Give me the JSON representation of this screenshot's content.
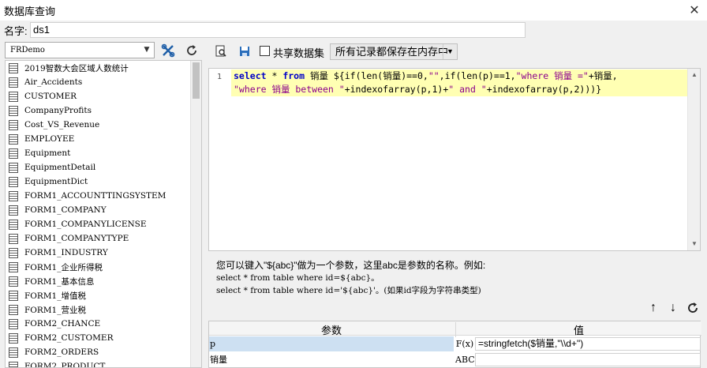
{
  "window": {
    "title": "数据库查询",
    "close_glyph": "✕"
  },
  "name_field": {
    "label": "名字:",
    "value": "ds1"
  },
  "left_panel": {
    "database_select": "FRDemo",
    "tables": [
      "2019智数大会区域人数统计",
      "Air_Accidents",
      "CUSTOMER",
      "CompanyProfits",
      "Cost_VS_Revenue",
      "EMPLOYEE",
      "Equipment",
      "EquipmentDetail",
      "EquipmentDict",
      "FORM1_ACCOUNTTINGSYSTEM",
      "FORM1_COMPANY",
      "FORM1_COMPANYLICENSE",
      "FORM1_COMPANYTYPE",
      "FORM1_INDUSTRY",
      "FORM1_企业所得税",
      "FORM1_基本信息",
      "FORM1_增值税",
      "FORM1_营业税",
      "FORM2_CHANCE",
      "FORM2_CUSTOMER",
      "FORM2_ORDERS",
      "FORM2_PRODUCT"
    ]
  },
  "toolbar": {
    "share_label": "共享数据集",
    "storage_select": "所有记录都保存在内存中"
  },
  "editor": {
    "line_number": "1",
    "line1": [
      {
        "t": "select",
        "c": "kw"
      },
      {
        "t": " * ",
        "c": ""
      },
      {
        "t": "from",
        "c": "kw"
      },
      {
        "t": " 销量 ${if(len(销量)==0,",
        "c": ""
      },
      {
        "t": "\"\"",
        "c": "str"
      },
      {
        "t": ",if(len(p)==1,",
        "c": ""
      },
      {
        "t": "\"where 销量 =\"",
        "c": "str"
      },
      {
        "t": "+销量,",
        "c": ""
      }
    ],
    "line2": [
      {
        "t": "\"where 销量 between \"",
        "c": "str"
      },
      {
        "t": "+indexofarray(p,1)+",
        "c": ""
      },
      {
        "t": "\" and \"",
        "c": "str"
      },
      {
        "t": "+indexofarray(p,2)))}",
        "c": ""
      }
    ]
  },
  "help": {
    "line1": "您可以键入\"${abc}\"做为一个参数，这里abc是参数的名称。例如:",
    "line2": "select * from table where id=${abc}。",
    "line3": "select * from table where id='${abc}'。(如果id字段为字符串类型)"
  },
  "params": {
    "header_param": "参数",
    "header_value": "值",
    "rows": [
      {
        "name": "p",
        "fx": "F(x)",
        "value": "=stringfetch($销量,\"\\\\d+\")"
      },
      {
        "name": "销量",
        "fx": "ABC",
        "value": ""
      }
    ]
  }
}
